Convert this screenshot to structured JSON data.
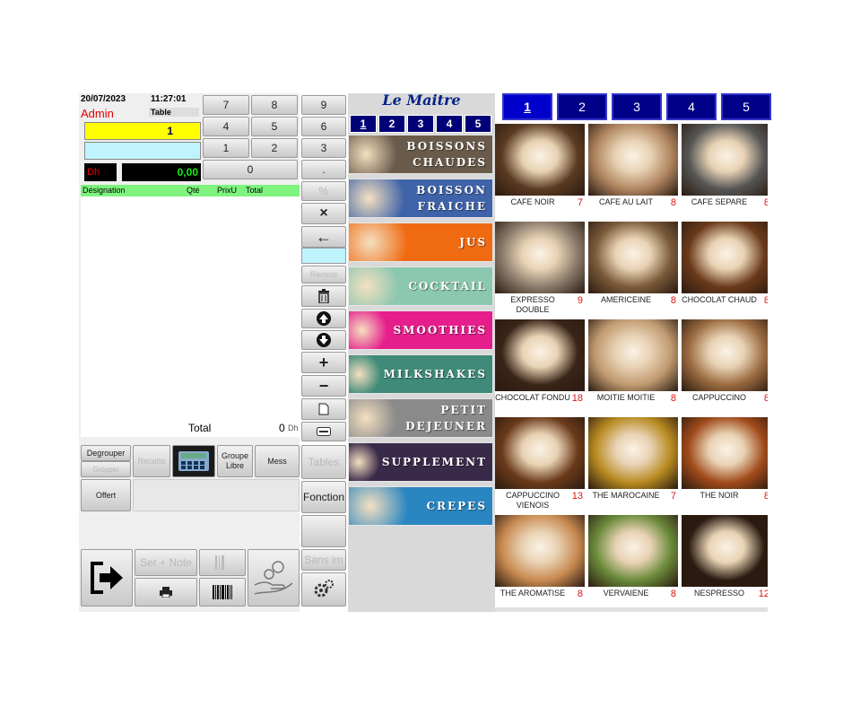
{
  "header": {
    "date": "20/07/2023",
    "time": "11:27:01",
    "user": "Admin",
    "table_label": "Table"
  },
  "order": {
    "table_value": "1",
    "currency": "Dh",
    "amount": "0,00"
  },
  "ticket": {
    "columns": [
      "Désignation",
      "Qté",
      "PrixU",
      "Total"
    ],
    "total_label": "Total",
    "total_value": "0",
    "total_unit": "Dh"
  },
  "keypad": [
    "7",
    "8",
    "9",
    "4",
    "5",
    "6",
    "1",
    "2",
    "3",
    "0",
    "."
  ],
  "side_keys": {
    "percent": "%",
    "times": "×",
    "remise": "Remise",
    "plus": "+",
    "minus": "−",
    "tables": "Tables",
    "fonction": "Fonction",
    "sans_im": "Sans im"
  },
  "actions": {
    "degrouper": "Degrouper",
    "grouper": "Grouper",
    "recette": "Recette",
    "groupe_libre": "Groupe Libre",
    "mess": "Mess",
    "offert": "Offert",
    "ser_note": "Ser + Note"
  },
  "brand": "Le Maitre",
  "category_tabs": [
    "1",
    "2",
    "3",
    "4",
    "5"
  ],
  "categories": [
    {
      "label": "BOISSONS CHAUDES",
      "color": "#6a5a4a"
    },
    {
      "label": "BOISSON FRAICHE",
      "color": "#3f63a8"
    },
    {
      "label": "JUS",
      "color": "#f06a12"
    },
    {
      "label": "COCKTAIL",
      "color": "#8cc7b0"
    },
    {
      "label": "SMOOTHIES",
      "color": "#e61e8c"
    },
    {
      "label": "MILKSHAKES",
      "color": "#3f8a78"
    },
    {
      "label": "PETIT DEJEUNER",
      "color": "#8a8a8a"
    },
    {
      "label": "SUPPLEMENT",
      "color": "#3a2a4a"
    },
    {
      "label": "CREPES",
      "color": "#2a86c0"
    }
  ],
  "page_tabs": [
    "1",
    "2",
    "3",
    "4",
    "5"
  ],
  "products": [
    {
      "name": "CAFE NOIR",
      "price": "7",
      "icon": "coffee-cup",
      "color": "#5a3a22"
    },
    {
      "name": "CAFE AU LAIT",
      "price": "8",
      "icon": "latte-glass",
      "color": "#b08660"
    },
    {
      "name": "CAFE SEPARE",
      "price": "8",
      "icon": "split-cups",
      "color": "#555555"
    },
    {
      "name": "EXPRESSO DOUBLE",
      "price": "9",
      "icon": "espresso-cups",
      "color": "#8a7a6a"
    },
    {
      "name": "AMERICEINE",
      "price": "8",
      "icon": "coffee-cup",
      "color": "#7a5a3a"
    },
    {
      "name": "CHOCOLAT CHAUD",
      "price": "8",
      "icon": "chocolate-cup",
      "color": "#6a3a1a"
    },
    {
      "name": "CHOCOLAT FONDU",
      "price": "18",
      "icon": "chocolate-glasses",
      "color": "#3a2418"
    },
    {
      "name": "MOITIE MOITIE",
      "price": "8",
      "icon": "latte-art",
      "color": "#c09a70"
    },
    {
      "name": "CAPPUCCINO",
      "price": "8",
      "icon": "cappuccino-glass",
      "color": "#9a6a40"
    },
    {
      "name": "CAPPUCCINO VIENOIS",
      "price": "13",
      "icon": "cream-cup",
      "color": "#6a3a1a"
    },
    {
      "name": "THE MAROCAINE",
      "price": "7",
      "icon": "tea-glasses",
      "color": "#b88a20"
    },
    {
      "name": "THE NOIR",
      "price": "8",
      "icon": "tea-cup",
      "color": "#a04a1a"
    },
    {
      "name": "THE AROMATISE",
      "price": "8",
      "icon": "tea-cups",
      "color": "#c88a50"
    },
    {
      "name": "VERVAIENE",
      "price": "8",
      "icon": "herb-tea",
      "color": "#6a8a3a"
    },
    {
      "name": "NESPRESSO",
      "price": "12",
      "icon": "nespresso-cup",
      "color": "#2a1a10"
    }
  ]
}
